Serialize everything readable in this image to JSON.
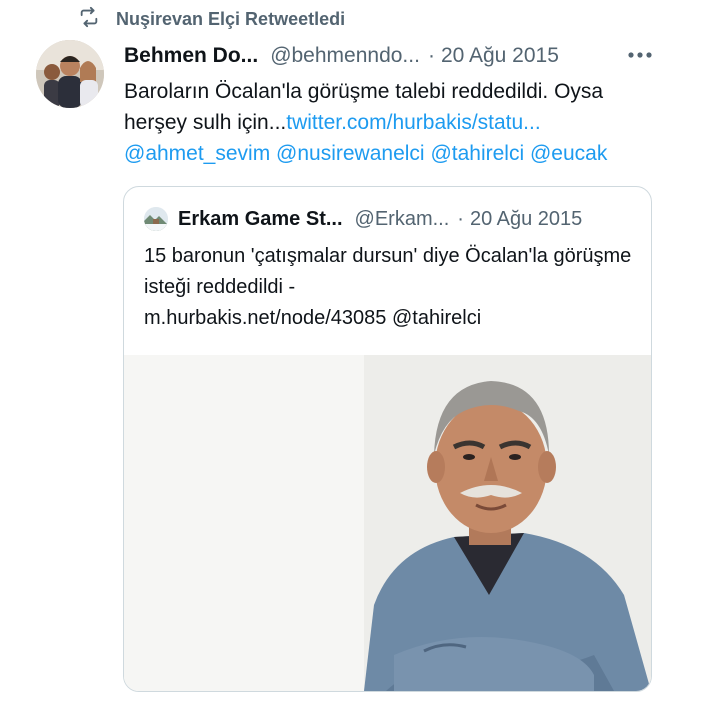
{
  "retweet": {
    "icon": "retweet-icon",
    "label": "Nuşirevan Elçi Retweetledi"
  },
  "tweet": {
    "avatar_icon": "profile-photo",
    "name": "Behmen Do...",
    "handle": "@behmenndo...",
    "separator": "·",
    "date": "20 Ağu 2015",
    "more_icon": "more-options-icon",
    "text": "Baroların Öcalan'la görüşme talebi reddedildi. Oysa herşey sulh için...",
    "link": "twitter.com/hurbakis/statu...",
    "mentions": [
      "@ahmet_sevim",
      "@nusirewanelci",
      "@tahirelci",
      "@eucak"
    ]
  },
  "quote": {
    "avatar_icon": "snowy-landscape-avatar",
    "name": "Erkam Game St...",
    "handle": "@Erkam...",
    "separator": "·",
    "date": "20 Ağu 2015",
    "text": "15 baronun 'çatışmalar dursun' diye Öcalan'la görüşme isteği reddedildi  -",
    "link": "m.hurbakis.net/node/43085",
    "mention": "@tahirelci",
    "image_icon": "portrait-photo"
  },
  "colors": {
    "text": "#0f1419",
    "secondary": "#536471",
    "link": "#1d9bf0",
    "border": "#cfd9de"
  }
}
